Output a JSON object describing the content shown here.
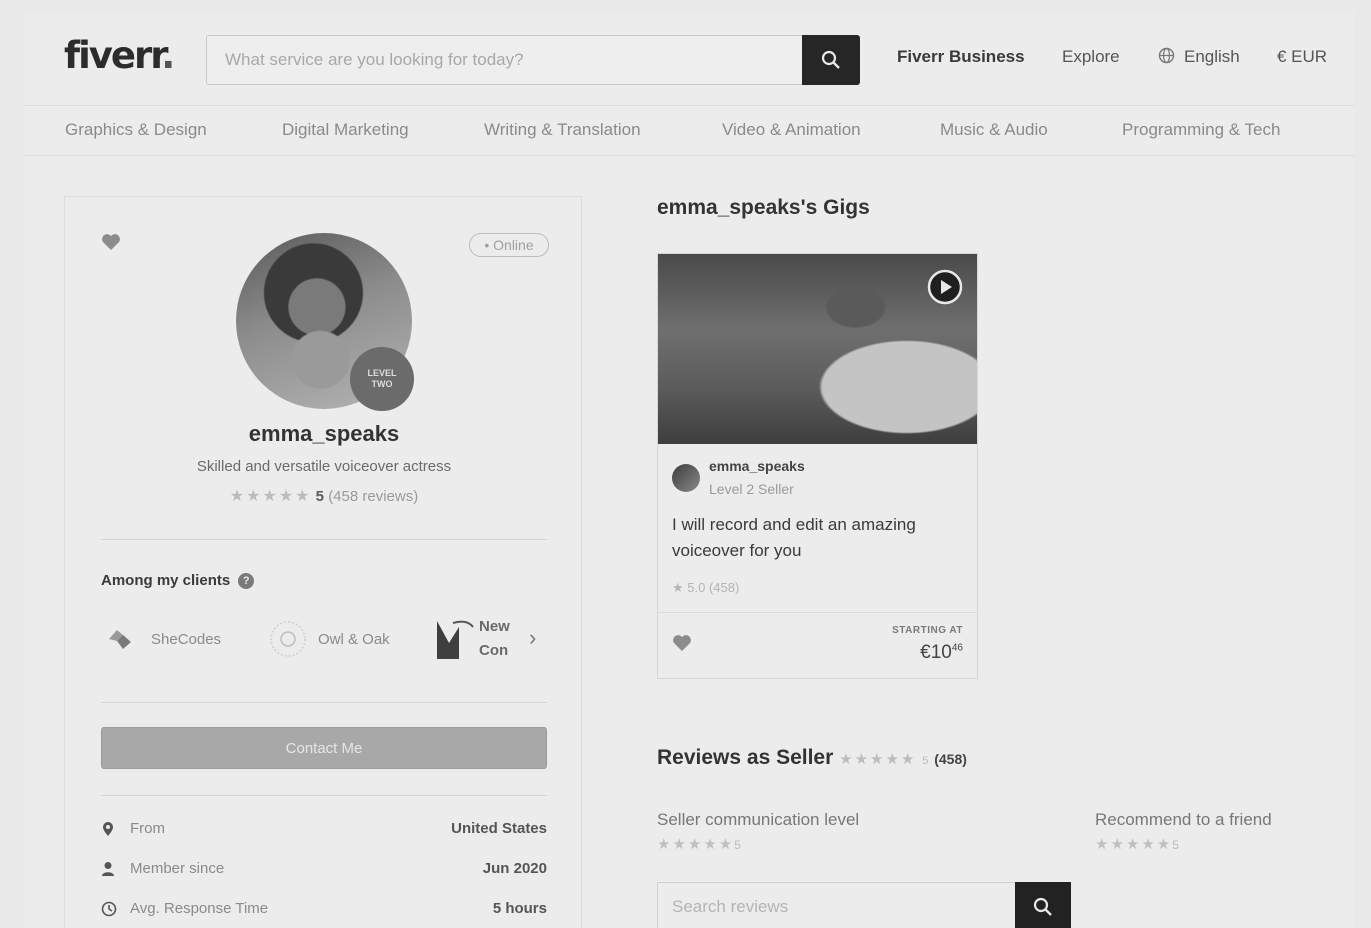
{
  "header": {
    "logo_text": "fiverr",
    "logo_dot": ".",
    "search_placeholder": "What service are you looking for today?",
    "nav": [
      "Fiverr Business",
      "Explore",
      "English",
      "€ EUR"
    ]
  },
  "categories": [
    "Graphics & Design",
    "Digital Marketing",
    "Writing & Translation",
    "Video & Animation",
    "Music & Audio",
    "Programming & Tech"
  ],
  "profile": {
    "status": "• Online",
    "level_badge_line1": "LEVEL",
    "level_badge_line2": "TWO",
    "username": "emma_speaks",
    "tagline": "Skilled and versatile voiceover actress",
    "stars": "★★★★★",
    "rating": "5",
    "review_count": "(458 reviews)",
    "clients_title": "Among my clients",
    "clients": [
      "SheCodes",
      "Owl & Oak",
      "New Con"
    ],
    "contact_label": "Contact Me",
    "info": [
      {
        "label": "From",
        "value": "United States"
      },
      {
        "label": "Member since",
        "value": "Jun 2020"
      },
      {
        "label": "Avg. Response Time",
        "value": "5 hours"
      }
    ]
  },
  "gigs": {
    "title": "emma_speaks's Gigs",
    "card": {
      "seller": "emma_speaks",
      "seller_level": "Level 2 Seller",
      "description": "I will record and edit an amazing voiceover for you",
      "rating": "★ 5.0 (458)",
      "starting_at": "STARTING AT",
      "price": "€10",
      "price_cents": "46"
    }
  },
  "reviews": {
    "title": "Reviews as Seller",
    "stars": "★★★★★",
    "rating": "5",
    "count": "(458)",
    "sub_ratings": [
      {
        "label": "Seller communication level",
        "stars": "★★★★★",
        "value": "5"
      },
      {
        "label": "Recommend to a friend",
        "stars": "★★★★★",
        "value": "5"
      }
    ],
    "search_placeholder": "Search reviews"
  },
  "colors": {
    "dark_button": "#262626",
    "contact_button": "#a8a8a8",
    "star": "#bcbcbc"
  }
}
